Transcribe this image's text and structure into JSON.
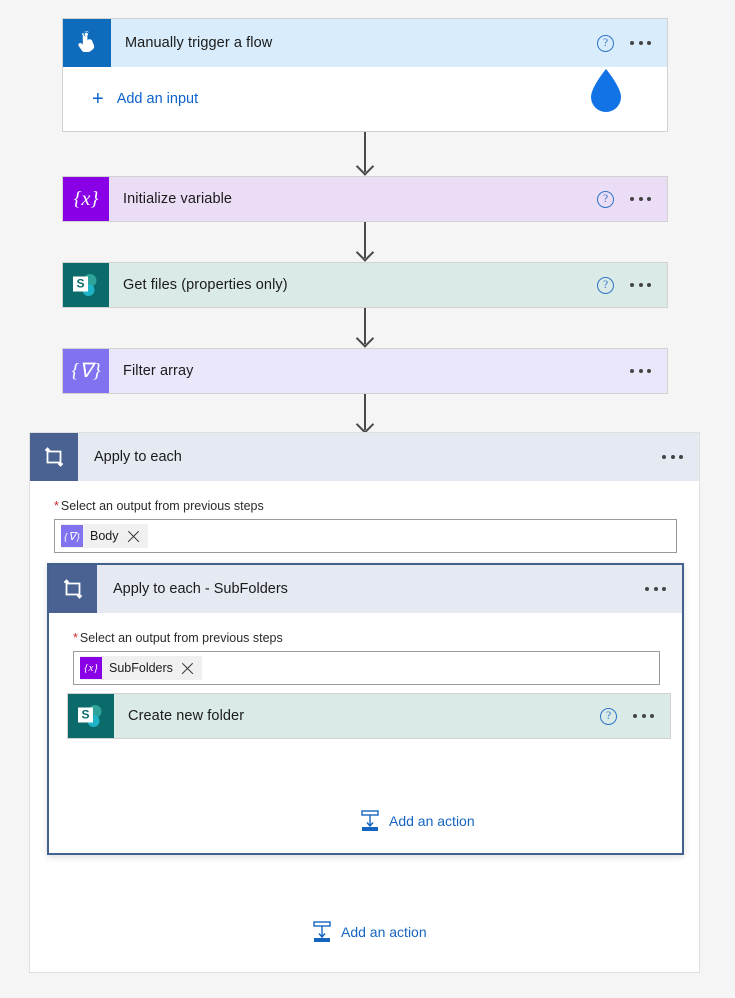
{
  "colors": {
    "page_bg": "#f5f5f5",
    "trigger_header_bg": "#d9ecfb",
    "trigger_icon_bg": "#0f6cbd",
    "variable_card_bg": "#ecddf7",
    "variable_icon_bg": "#8a00e6",
    "sharepoint_card_bg": "#d9eae7",
    "sharepoint_icon_bg": "#0b6a6a",
    "filter_card_bg": "#ebe7fb",
    "filter_icon_bg": "#8172f0",
    "loop_header_bg": "#e4e9f2",
    "loop_icon_bg": "#4a6291",
    "inner_loop_border": "#41628f",
    "link_blue": "#1565c0",
    "help_blue": "#2f75c9",
    "required_red": "#c52b2b",
    "connector_gray": "#4a4a4a",
    "droplet_blue": "#1273e6"
  },
  "trigger": {
    "title": "Manually trigger a flow",
    "icon": "touch-tap-icon",
    "help_label": "?",
    "more_label": "More commands",
    "add_input_label": "Add an input",
    "add_input_icon": "plus-icon",
    "cursor_icon": "water-drop-cursor-icon"
  },
  "steps": [
    {
      "id": "initialize-variable",
      "title": "Initialize variable",
      "icon": "variable-braces-icon",
      "glyph": "{x}",
      "has_help": true
    },
    {
      "id": "get-files-properties-only",
      "title": "Get files (properties only)",
      "icon": "sharepoint-icon",
      "glyph": "S",
      "has_help": true
    },
    {
      "id": "filter-array",
      "title": "Filter array",
      "icon": "filter-funnel-braces-icon",
      "glyph": "{∇}",
      "has_help": false
    }
  ],
  "outer_loop": {
    "title": "Apply to each",
    "icon": "loop-repeat-icon",
    "more_label": "More commands",
    "field": {
      "label": "Select an output from previous steps",
      "required_marker": "*",
      "token": {
        "label": "Body",
        "icon": "filter-funnel-braces-icon",
        "glyph": "{∇}",
        "remove_icon": "close-x-icon"
      }
    },
    "add_action_label": "Add an action",
    "add_action_icon": "insert-action-icon"
  },
  "inner_loop": {
    "title": "Apply to each - SubFolders",
    "icon": "loop-repeat-icon",
    "more_label": "More commands",
    "field": {
      "label": "Select an output from previous steps",
      "required_marker": "*",
      "token": {
        "label": "SubFolders",
        "icon": "variable-braces-icon",
        "glyph": "{x}",
        "remove_icon": "close-x-icon"
      }
    },
    "action": {
      "id": "create-new-folder",
      "title": "Create new folder",
      "icon": "sharepoint-icon",
      "glyph": "S",
      "has_help": true
    },
    "add_action_label": "Add an action",
    "add_action_icon": "insert-action-icon"
  }
}
